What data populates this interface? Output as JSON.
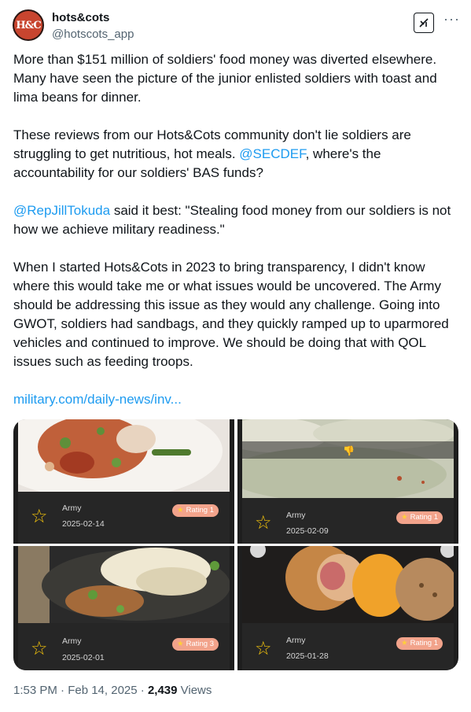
{
  "header": {
    "avatar_text": "H&C",
    "display_name": "hots&cots",
    "handle": "@hotscots_app",
    "more_label": "···"
  },
  "tweet": {
    "p1": "More than $151 million of soldiers' food money was diverted elsewhere. Many have seen the picture of the junior enlisted soldiers with toast and lima beans for dinner.",
    "p2_before": "These reviews from our Hots&Cots community don't lie soldiers are struggling to get nutritious, hot meals. ",
    "p2_mention": "@SECDEF",
    "p2_after": ", where's the accountability for our soldiers' BAS funds?",
    "p3_mention": "@RepJillTokuda",
    "p3_after": " said it best: \"Stealing food money from our soldiers is not how we achieve military readiness.\"",
    "p4": "When I started Hots&Cots in 2023 to bring transparency, I didn't know where this would take me or what issues would be uncovered. The Army should be addressing this issue as they would any challenge. Going into GWOT, soldiers had sandbags, and they quickly ramped up to uparmored vehicles and continued to improve. We should be doing that with QOL issues such as feeding troops.",
    "link": "military.com/daily-news/inv..."
  },
  "reviews": [
    {
      "branch": "Army",
      "date": "2025-02-14",
      "rating": "Rating 1"
    },
    {
      "branch": "Army",
      "date": "2025-02-09",
      "rating": "Rating 1"
    },
    {
      "branch": "Army",
      "date": "2025-02-01",
      "rating": "Rating 3"
    },
    {
      "branch": "Army",
      "date": "2025-01-28",
      "rating": "Rating 1"
    }
  ],
  "meta": {
    "time": "1:53 PM · Feb 14, 2025 · ",
    "views_count": "2,439",
    "views_label": " Views"
  },
  "colors": {
    "link": "#1d9bf0",
    "star": "#f2c20c",
    "rating_badge": "#f2a38b",
    "card_bg": "#262626"
  }
}
